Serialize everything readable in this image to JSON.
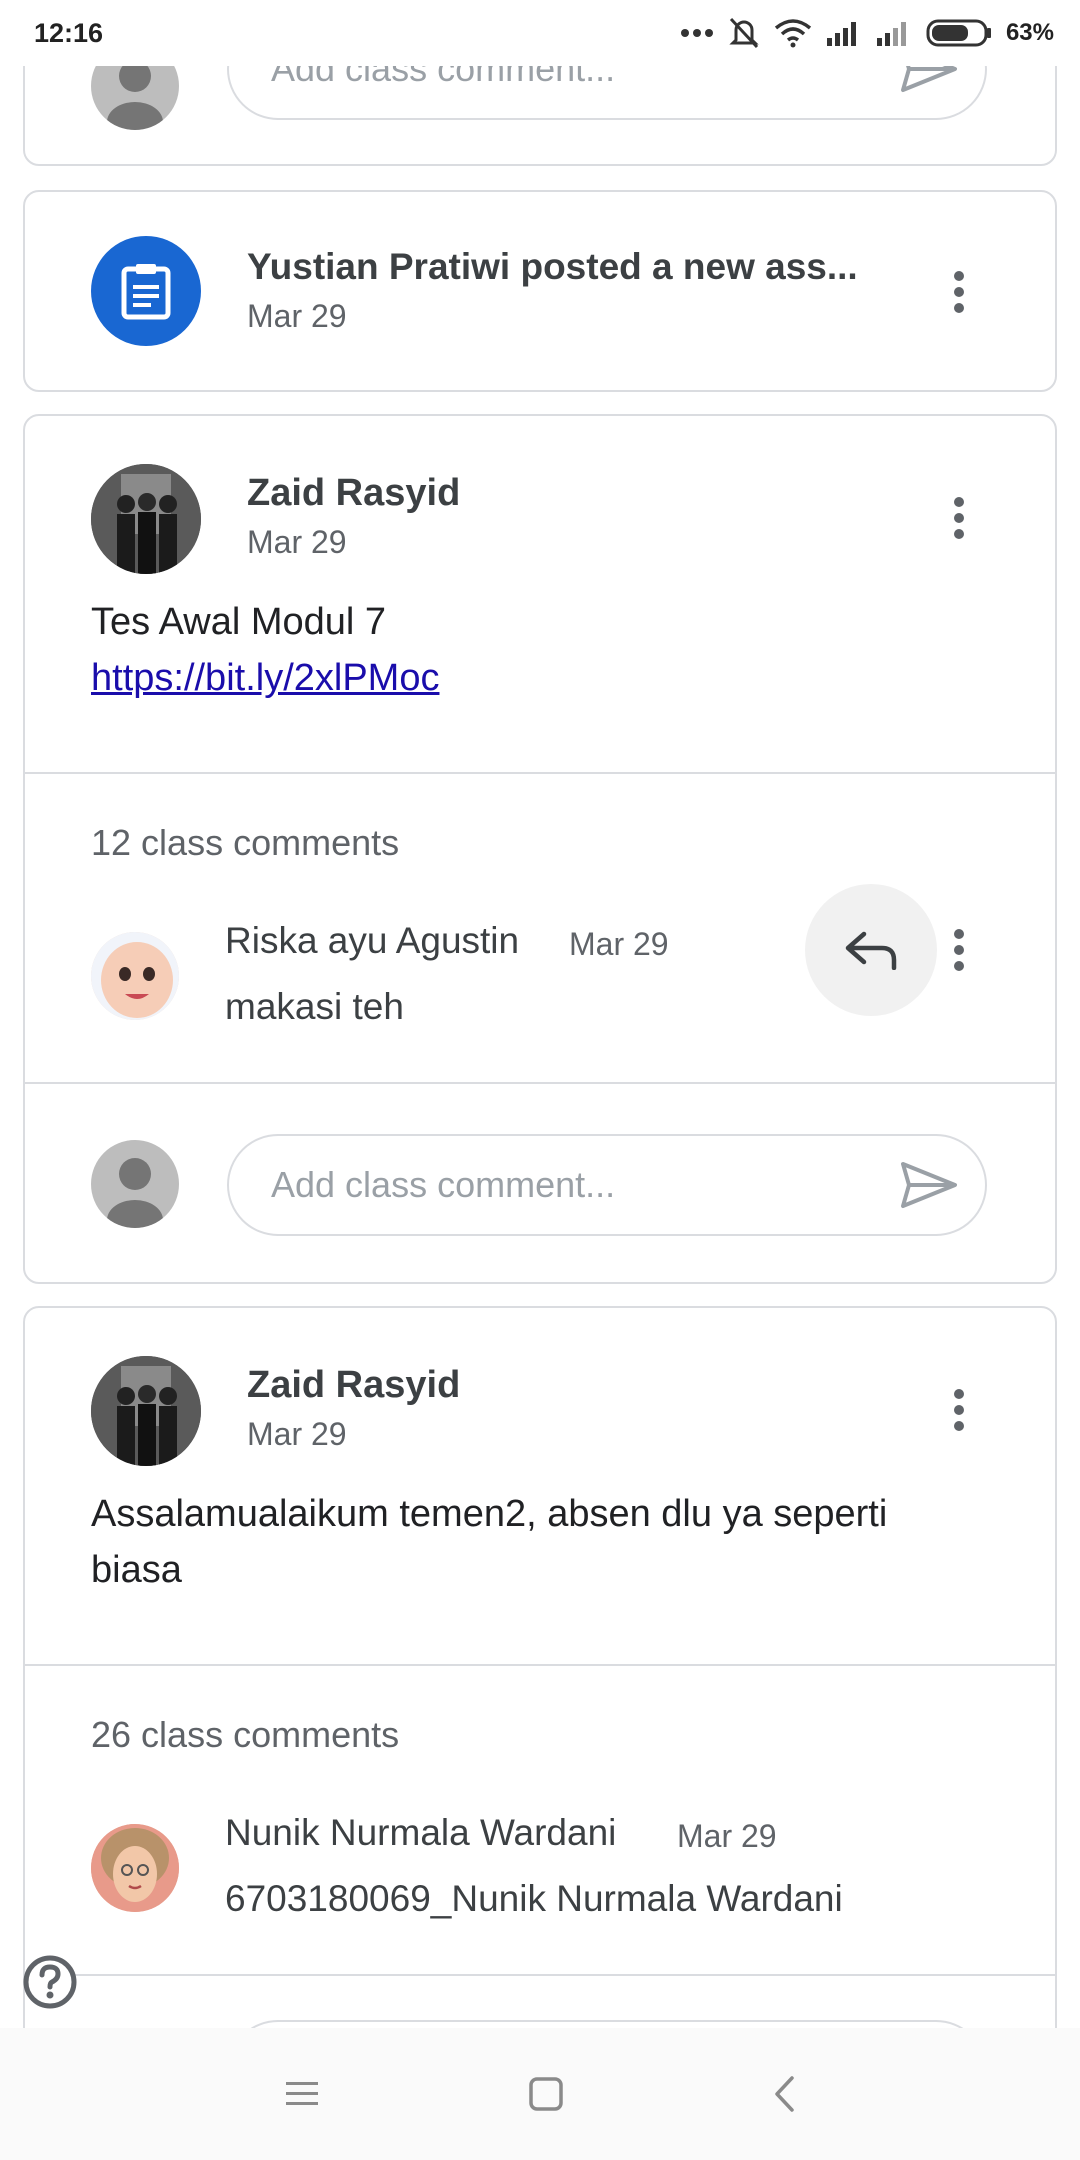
{
  "status_bar": {
    "time": "12:16",
    "battery": "63%"
  },
  "top_partial": {
    "comment_placeholder": "Add class comment..."
  },
  "assignment_card": {
    "title": "Yustian Pratiwi posted a new ass...",
    "date": "Mar 29"
  },
  "post1": {
    "author": "Zaid Rasyid",
    "date": "Mar 29",
    "line1": "Tes Awal Modul 7",
    "link": "https://bit.ly/2xlPMoc",
    "comments_count": "12 class comments",
    "comment": {
      "author": "Riska ayu Agustin",
      "date": "Mar 29",
      "text": "makasi teh"
    },
    "comment_placeholder": "Add class comment..."
  },
  "post2": {
    "author": "Zaid Rasyid",
    "date": "Mar 29",
    "text": "Assalamualaikum temen2, absen dlu ya seperti biasa",
    "comments_count": "26 class comments",
    "comment": {
      "author": "Nunik Nurmala Wardani",
      "date": "Mar 29",
      "text": "6703180069_Nunik Nurmala Wardani"
    }
  },
  "colors": {
    "accent_blue": "#1967d2",
    "divider": "#dadce0"
  },
  "icons": [
    "assignment-icon",
    "more-vert-icon",
    "reply-icon",
    "send-icon",
    "help-icon",
    "menu-icon",
    "home-square-icon",
    "back-icon"
  ]
}
